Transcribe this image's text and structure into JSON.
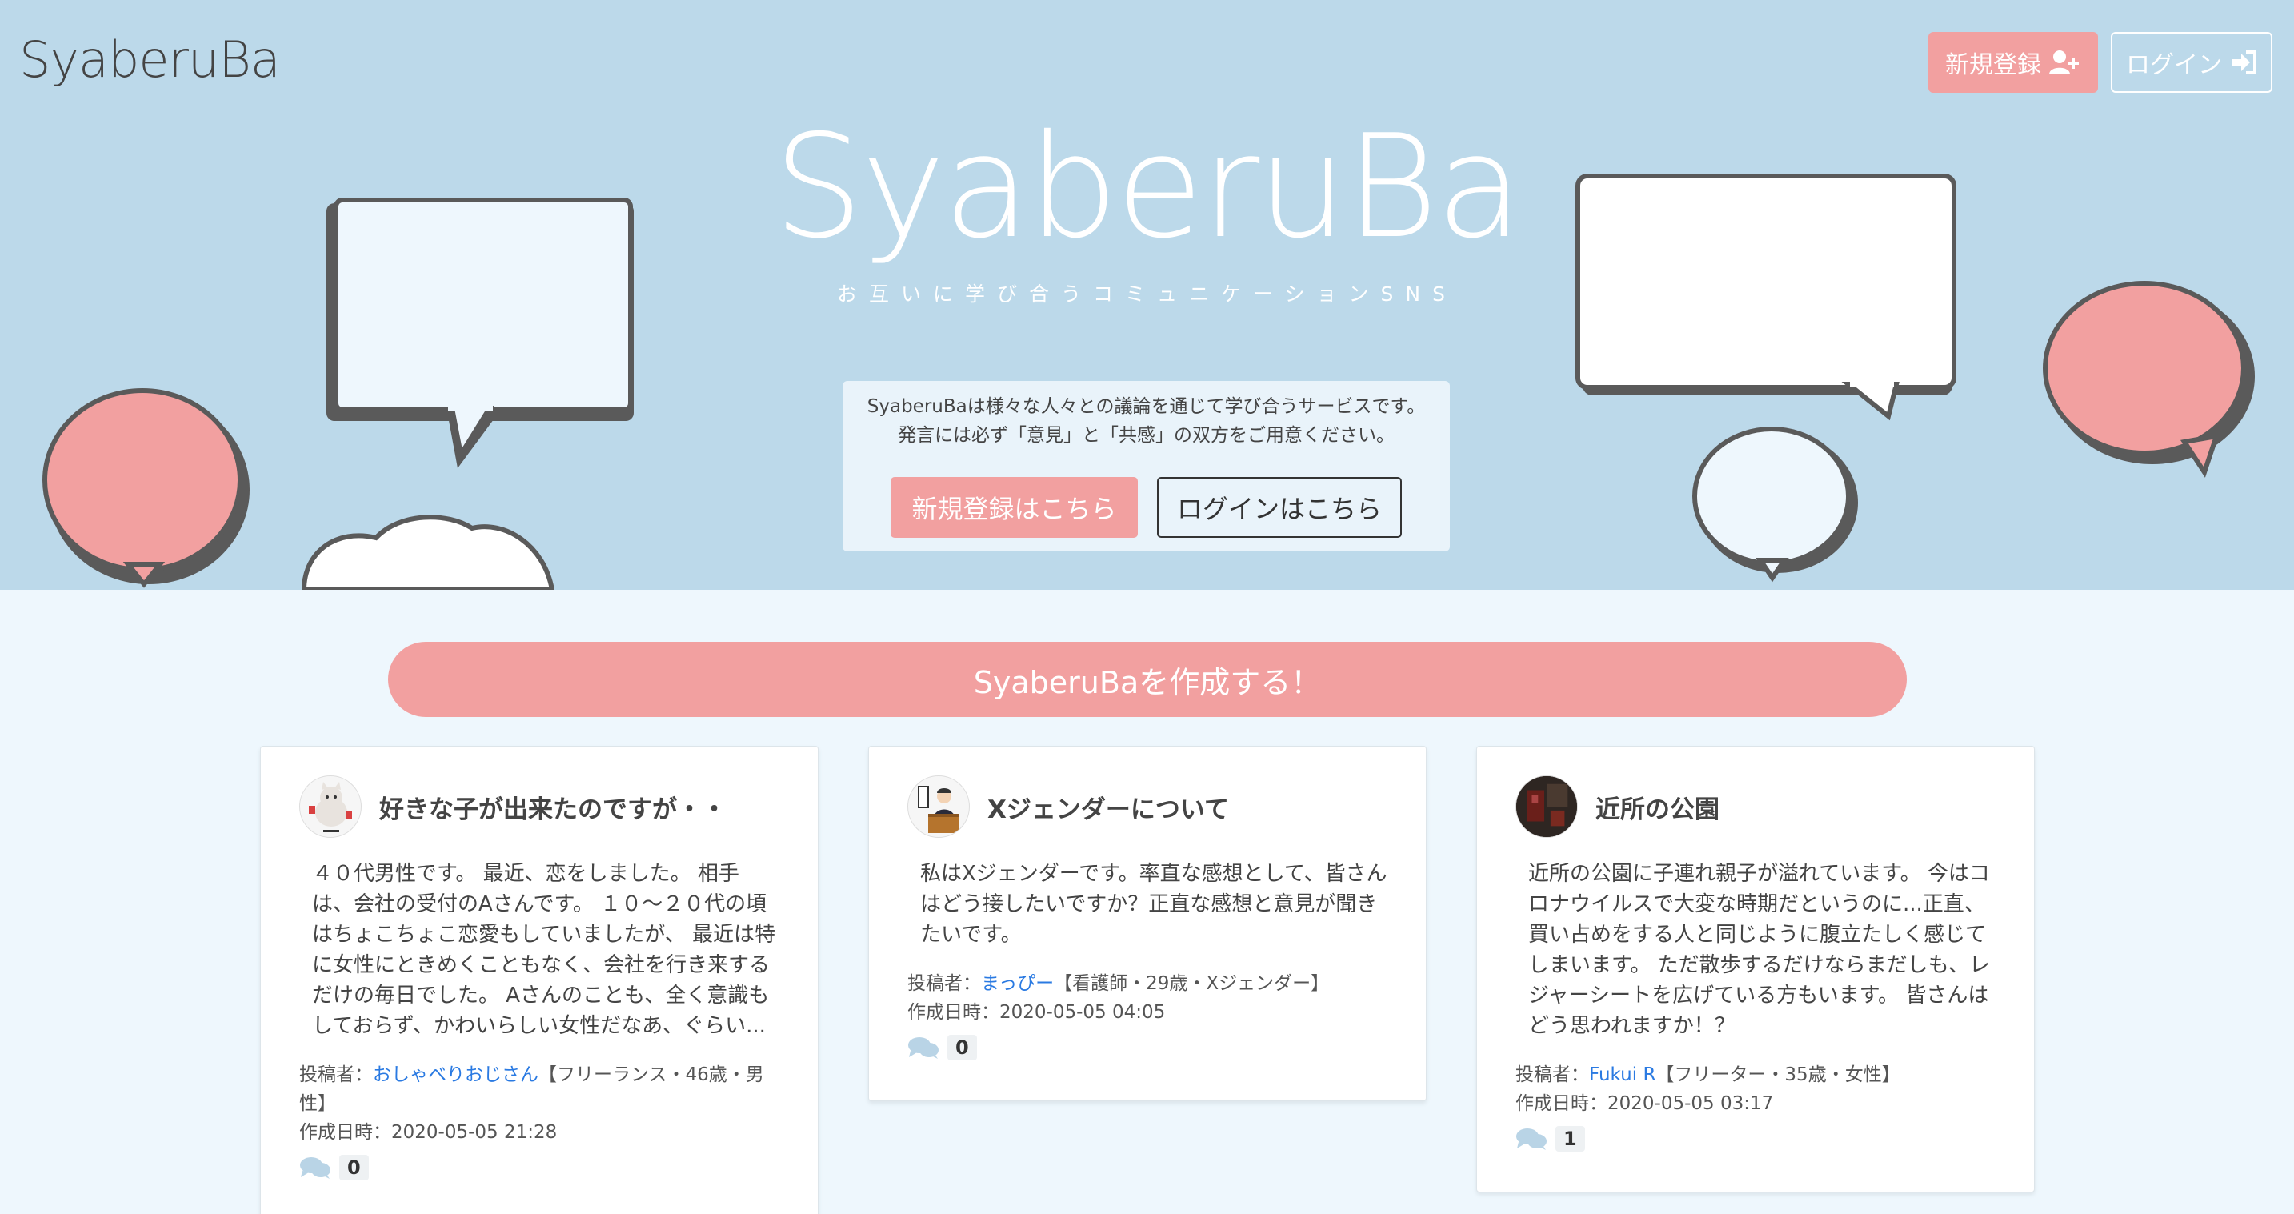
{
  "brand": "SyaberuBa",
  "hero": {
    "title": "SyaberuBa",
    "subtitle": "お互いに学び合うコミュニケーションSNS",
    "intro_line1": "SyaberuBaは様々な人々との議論を通じて学び合うサービスです。",
    "intro_line2": "発言には必ず「意見」と「共感」の双方をご用意ください。",
    "register_label": "新規登録はこちら",
    "login_label": "ログインはこちら"
  },
  "header": {
    "register_label": "新規登録",
    "login_label": "ログイン"
  },
  "create_button": "SyaberuBaを作成する！",
  "colors": {
    "hero_bg": "#bcd9ea",
    "page_bg": "#eef7fd",
    "accent_pink": "#f2a0a0",
    "link_blue": "#2a7ae2"
  },
  "posts": [
    {
      "title": "好きな子が出来たのですが・・",
      "body": "４０代男性です。 最近、恋をしました。 相手は、会社の受付のAさんです。 １０〜２０代の頃はちょこちょこ恋愛もしていましたが、 最近は特に女性にときめくこともなく、会社を行き来するだけの毎日でした。 Aさんのことも、全く意識もしておらず、かわいらしい女性だなあ、ぐらい...",
      "author_prefix": "投稿者：",
      "author": "おしゃべりおじさん",
      "author_info": "【フリーランス・46歳・男性】",
      "date_prefix": "作成日時：",
      "date": "2020-05-05 21:28",
      "comment_count": "0",
      "avatar_icon": "cat-character-icon"
    },
    {
      "title": "Xジェンダーについて",
      "body": "私はXジェンダーです。率直な感想として、皆さんはどう接したいですか？正直な感想と意見が聞きたいです。",
      "author_prefix": "投稿者：",
      "author": "まっぴー",
      "author_info": "【看護師・29歳・Xジェンダー】",
      "date_prefix": "作成日時：",
      "date": "2020-05-05 04:05",
      "comment_count": "0",
      "avatar_icon": "speaker-at-podium-icon"
    },
    {
      "title": "近所の公園",
      "body": "近所の公園に子連れ親子が溢れています。 今はコロナウイルスで大変な時期だというのに...正直、買い占めをする人と同じように腹立たしく感じてしまいます。 ただ散歩するだけならまだしも、レジャーシートを広げている方もいます。 皆さんはどう思われますか！？",
      "author_prefix": "投稿者：",
      "author": "Fukui R",
      "author_info": "【フリーター・35歳・女性】",
      "date_prefix": "作成日時：",
      "date": "2020-05-05 03:17",
      "comment_count": "1",
      "avatar_icon": "photo-avatar-icon"
    }
  ]
}
